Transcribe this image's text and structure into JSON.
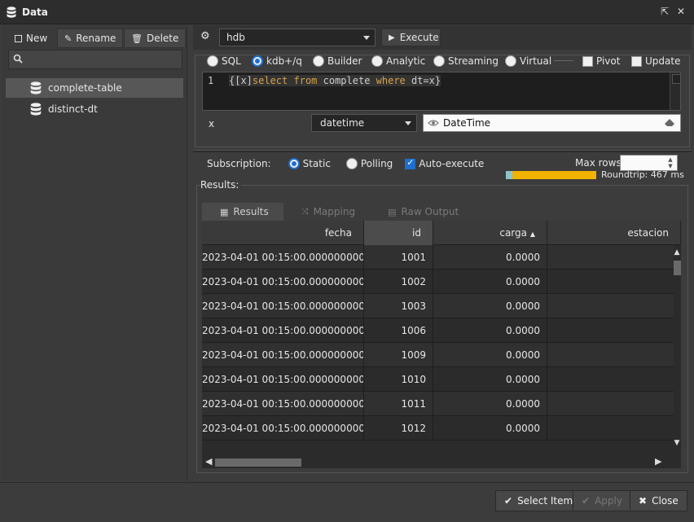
{
  "window": {
    "title": "Data"
  },
  "left": {
    "toolbar": {
      "new": "New",
      "rename": "Rename",
      "delete": "Delete"
    },
    "search": {
      "placeholder": ""
    },
    "items": [
      {
        "label": "complete-table",
        "selected": true
      },
      {
        "label": "distinct-dt",
        "selected": false
      }
    ]
  },
  "toolbar": {
    "server": "hdb",
    "execute": "Execute"
  },
  "query": {
    "modes": [
      {
        "label": "SQL",
        "selected": false
      },
      {
        "label": "kdb+/q",
        "selected": true
      },
      {
        "label": "Builder",
        "selected": false
      },
      {
        "label": "Analytic",
        "selected": false
      },
      {
        "label": "Streaming",
        "selected": false
      },
      {
        "label": "Virtual",
        "selected": false
      }
    ],
    "pivot": {
      "label": "Pivot",
      "checked": false
    },
    "update": {
      "label": "Update",
      "checked": false
    },
    "line_number": "1",
    "code_parts": [
      "{[x]",
      "select",
      " ",
      "from",
      " complete ",
      "where",
      " dt=x}"
    ],
    "param": {
      "name": "x",
      "type": "datetime",
      "value": "DateTime"
    }
  },
  "subscription": {
    "label": "Subscription:",
    "static": "Static",
    "polling": "Polling",
    "auto_execute": "Auto-execute",
    "max_rows_label": "Max rows:",
    "max_rows_value": "",
    "roundtrip": "Roundtrip: 467 ms"
  },
  "results": {
    "section_label": "Results:",
    "tabs": [
      "Results",
      "Mapping",
      "Raw Output"
    ],
    "columns": [
      "fecha",
      "id",
      "carga",
      "estacion"
    ],
    "rows": [
      [
        "2023-04-01 00:15:00.000000000",
        "1001",
        "0.0000",
        ""
      ],
      [
        "2023-04-01 00:15:00.000000000",
        "1002",
        "0.0000",
        ""
      ],
      [
        "2023-04-01 00:15:00.000000000",
        "1003",
        "0.0000",
        ""
      ],
      [
        "2023-04-01 00:15:00.000000000",
        "1006",
        "0.0000",
        ""
      ],
      [
        "2023-04-01 00:15:00.000000000",
        "1009",
        "0.0000",
        ""
      ],
      [
        "2023-04-01 00:15:00.000000000",
        "1010",
        "0.0000",
        ""
      ],
      [
        "2023-04-01 00:15:00.000000000",
        "1011",
        "0.0000",
        ""
      ],
      [
        "2023-04-01 00:15:00.000000000",
        "1012",
        "0.0000",
        ""
      ]
    ]
  },
  "footer": {
    "select_item": "Select Item",
    "apply": "Apply",
    "close": "Close"
  },
  "colors": {
    "accent": "#1e6fd0",
    "roundtrip_bar": "#f2b200",
    "keyword": "#d7a24a"
  }
}
